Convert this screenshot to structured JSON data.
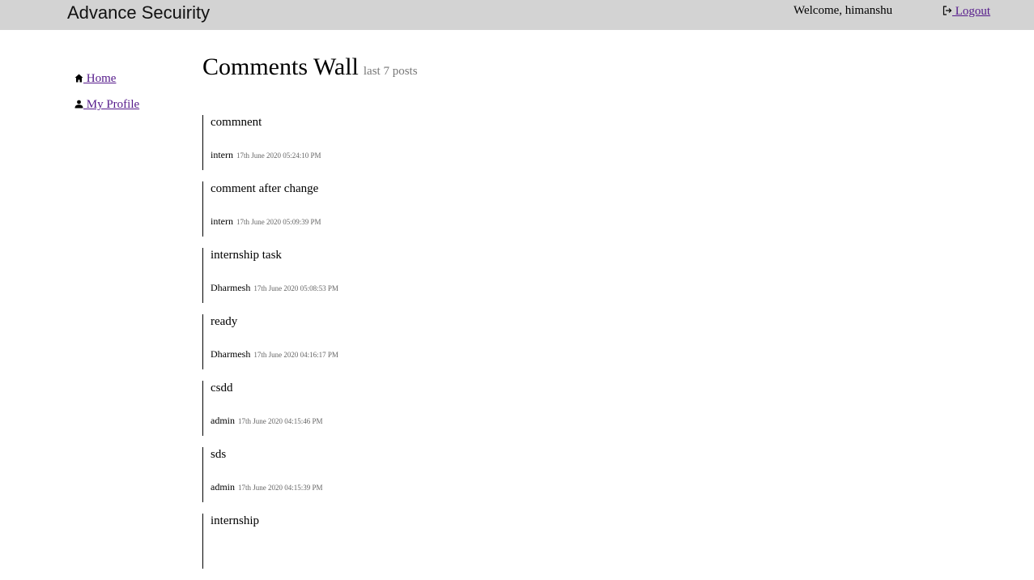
{
  "header": {
    "brand": "Advance Secuirity",
    "welcome": "Welcome, himanshu",
    "logout_label": " Logout",
    "logout_icon": "logout-icon"
  },
  "sidebar": {
    "items": [
      {
        "label": " Home",
        "icon": "home-icon"
      },
      {
        "label": " My Profile",
        "icon": "user-icon"
      }
    ]
  },
  "main": {
    "title": "Comments Wall",
    "subtitle": "last 7 posts",
    "posts": [
      {
        "text": "commnent",
        "author": "intern",
        "time": "17th June 2020 05:24:10 PM"
      },
      {
        "text": "comment after change",
        "author": "intern",
        "time": "17th June 2020 05:09:39 PM"
      },
      {
        "text": "internship task",
        "author": "Dharmesh",
        "time": "17th June 2020 05:08:53 PM"
      },
      {
        "text": "ready",
        "author": "Dharmesh",
        "time": "17th June 2020 04:16:17 PM"
      },
      {
        "text": "csdd",
        "author": "admin",
        "time": "17th June 2020 04:15:46 PM"
      },
      {
        "text": "sds",
        "author": "admin",
        "time": "17th June 2020 04:15:39 PM"
      },
      {
        "text": "internship",
        "author": "",
        "time": ""
      }
    ]
  },
  "colors": {
    "topbar": "#d3d3d3",
    "link": "#551a8b",
    "muted": "#777777"
  }
}
